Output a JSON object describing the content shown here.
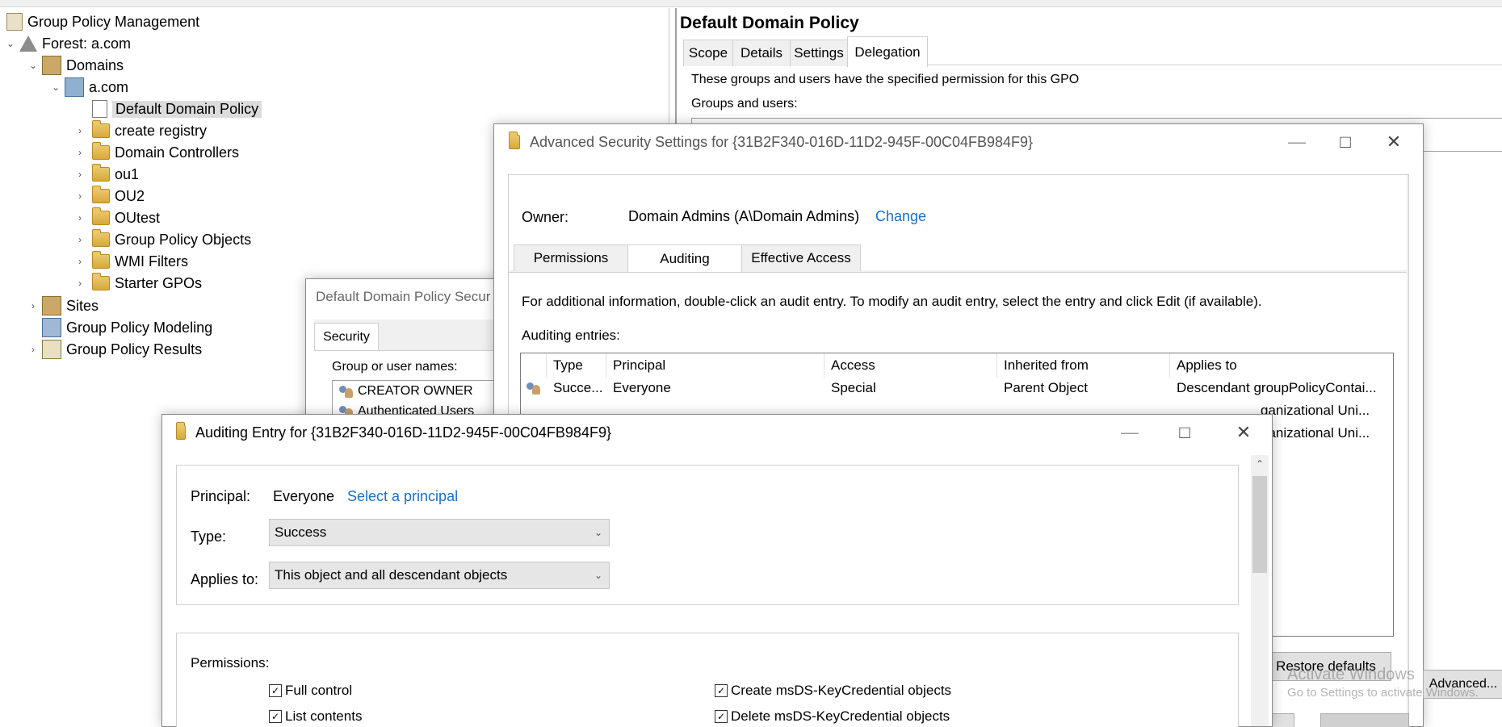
{
  "tree": {
    "root": "Group Policy Management",
    "forest": "Forest: a.com",
    "domains": "Domains",
    "domain": "a.com",
    "selected": "Default Domain Policy",
    "children": [
      "create registry",
      "Domain Controllers",
      "ou1",
      "OU2",
      "OUtest",
      "Group Policy Objects",
      "WMI Filters",
      "Starter GPOs"
    ],
    "sites": "Sites",
    "modeling": "Group Policy Modeling",
    "results": "Group Policy Results"
  },
  "gpo_pane": {
    "title": "Default Domain Policy",
    "tabs": [
      "Scope",
      "Details",
      "Settings",
      "Delegation"
    ],
    "active_tab": "Delegation",
    "description": "These groups and users have the specified permission for this GPO",
    "groups_label": "Groups and users:"
  },
  "security_dialog": {
    "title": "Default Domain Policy Secur",
    "tab": "Security",
    "group_label": "Group or user names:",
    "users": [
      "CREATOR OWNER",
      "Authenticated Users"
    ]
  },
  "advanced": {
    "title": "Advanced Security Settings for {31B2F340-016D-11D2-945F-00C04FB984F9}",
    "owner_label": "Owner:",
    "owner_value": "Domain Admins (A\\Domain Admins)",
    "change_link": "Change",
    "tabs": [
      "Permissions",
      "Auditing",
      "Effective Access"
    ],
    "active_tab": "Auditing",
    "info": "For additional information, double-click an audit entry. To modify an audit entry, select the entry and click Edit (if available).",
    "entries_label": "Auditing entries:",
    "columns": [
      "Type",
      "Principal",
      "Access",
      "Inherited from",
      "Applies to"
    ],
    "rows": [
      [
        "Succe...",
        "Everyone",
        "Special",
        "Parent Object",
        "Descendant groupPolicyContai..."
      ],
      [
        "",
        "",
        "",
        "",
        "ganizational Uni..."
      ],
      [
        "",
        "",
        "",
        "",
        "ganizational Uni..."
      ]
    ],
    "restore_button": "Restore defaults",
    "advanced_button": "Advanced..."
  },
  "audit_entry": {
    "title": "Auditing Entry for {31B2F340-016D-11D2-945F-00C04FB984F9}",
    "principal_label": "Principal:",
    "principal_value": "Everyone",
    "select_link": "Select a principal",
    "type_label": "Type:",
    "type_value": "Success",
    "applies_label": "Applies to:",
    "applies_value": "This object and all descendant objects",
    "permissions_label": "Permissions:",
    "perms_left": [
      "Full control",
      "List contents"
    ],
    "perms_right": [
      "Create msDS-KeyCredential objects",
      "Delete msDS-KeyCredential objects"
    ]
  },
  "watermark": {
    "line1": "Activate Windows",
    "line2": "Go to Settings to activate Windows."
  }
}
